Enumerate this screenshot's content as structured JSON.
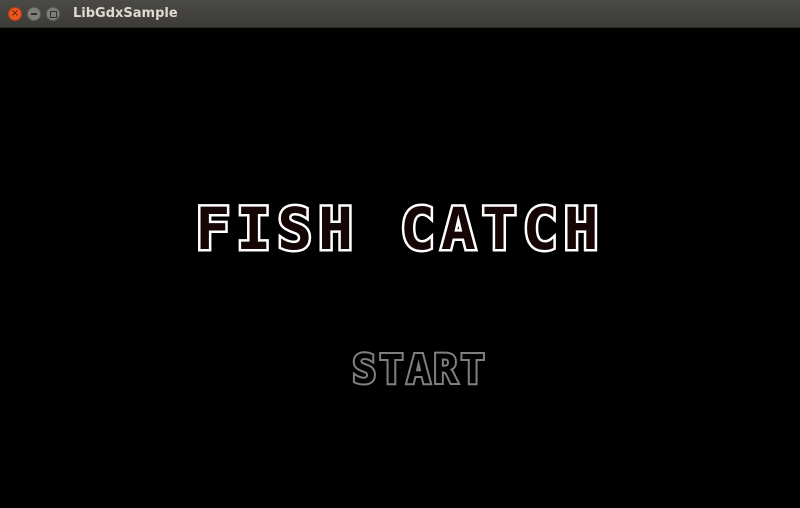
{
  "window": {
    "title": "LibGdxSample",
    "close_glyph": "×"
  },
  "game": {
    "title": "FISH CATCH",
    "start_label": "START"
  },
  "colors": {
    "background": "#000000",
    "title_outline": "#ffffff",
    "title_fill": "#150505",
    "start_outline": "#7f7f7f"
  }
}
